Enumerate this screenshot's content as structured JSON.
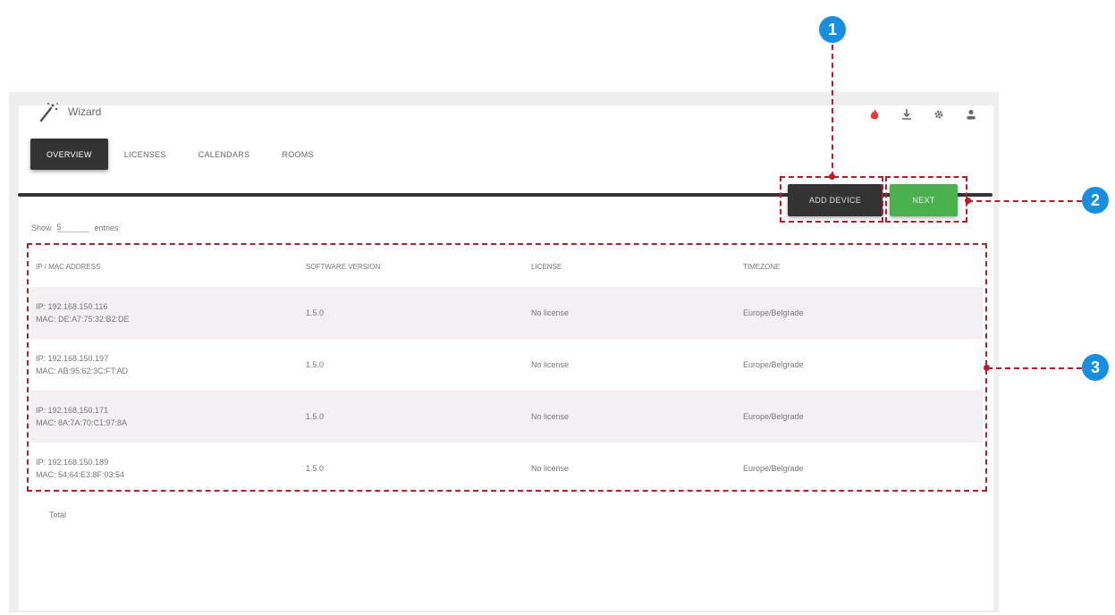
{
  "app": {
    "title": "Wizard"
  },
  "header_icons": [
    "fire-icon",
    "download-icon",
    "gear-icon",
    "user-icon"
  ],
  "tabs": [
    {
      "label": "OVERVIEW",
      "active": true
    },
    {
      "label": "LICENSES",
      "active": false
    },
    {
      "label": "CALENDARS",
      "active": false
    },
    {
      "label": "ROOMS",
      "active": false
    }
  ],
  "buttons": {
    "add_device": "ADD DEVICE",
    "next": "NEXT"
  },
  "show_entries": {
    "prefix": "Show",
    "value": "5",
    "suffix": "entries"
  },
  "table": {
    "columns": [
      "IP / MAC ADDRESS",
      "SOFTWARE VERSION",
      "LICENSE",
      "TIMEZONE"
    ],
    "rows": [
      {
        "ip": "IP: 192.168.150.116",
        "mac": "MAC: DE:A7:75:32:B2:DE",
        "version": "1.5.0",
        "license": "No license",
        "timezone": "Europe/Belgrade"
      },
      {
        "ip": "IP: 192.168.150.197",
        "mac": "MAC: AB:95:62:3C:FT:AD",
        "version": "1.5.0",
        "license": "No license",
        "timezone": "Europe/Belgrade"
      },
      {
        "ip": "IP: 192.168.150.171",
        "mac": "MAC: 8A:7A:70:C1:97:8A",
        "version": "1.5.0",
        "license": "No license",
        "timezone": "Europe/Belgrade"
      },
      {
        "ip": "IP: 192.168.150.189",
        "mac": "MAC: 54:64:E3:8F:03:54",
        "version": "1.5.0",
        "license": "No license",
        "timezone": "Europe/Belgrade"
      }
    ]
  },
  "total_label": "Total",
  "annotations": [
    "1",
    "2",
    "3"
  ],
  "colors": {
    "accent_dark": "#333333",
    "next_green": "#4caf50",
    "annotation_red": "#b0202a",
    "annotation_blue": "#1a8ede"
  }
}
